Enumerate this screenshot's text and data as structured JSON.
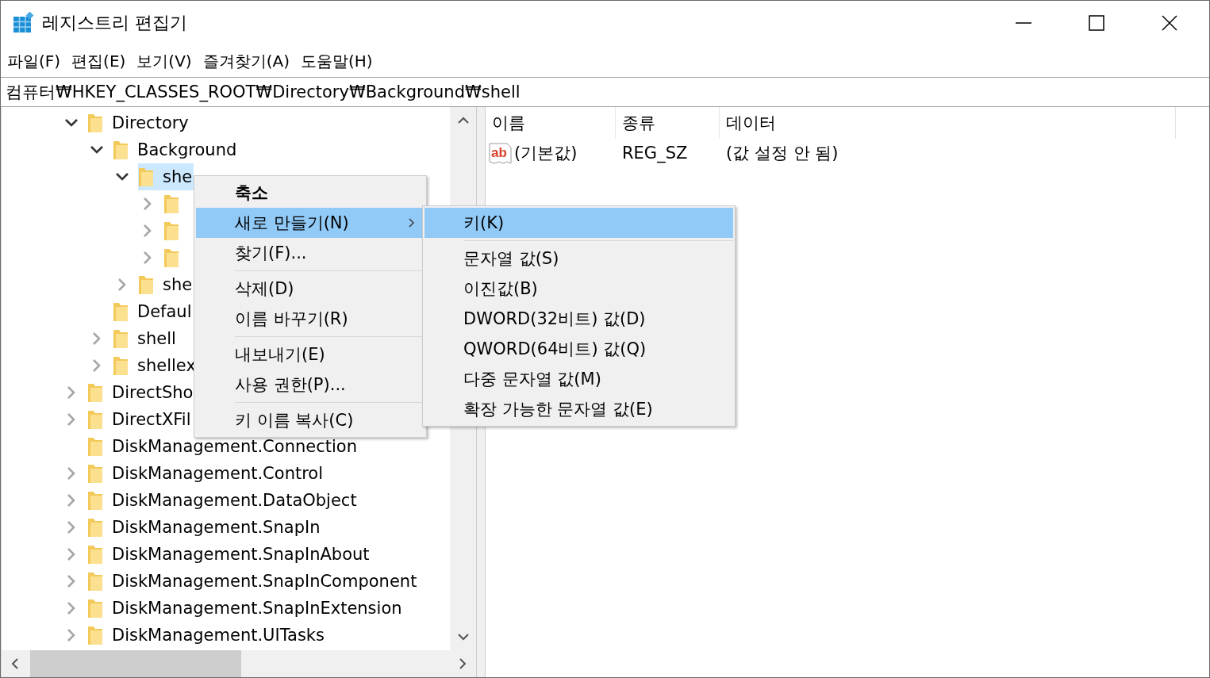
{
  "window": {
    "title": "레지스트리 편집기"
  },
  "menu_bar": [
    "파일(F)",
    "편집(E)",
    "보기(V)",
    "즐겨찾기(A)",
    "도움말(H)"
  ],
  "address": "컴퓨터₩HKEY_CLASSES_ROOT₩Directory₩Background₩shell",
  "tree": [
    {
      "label": "Directory",
      "expanded": true,
      "selected": false,
      "children": [
        {
          "label": "Background",
          "expanded": true,
          "selected": false,
          "children": [
            {
              "label": "she",
              "expanded": true,
              "selected": true,
              "children": [
                {
                  "expanded": false,
                  "selected": false
                },
                {
                  "expanded": false,
                  "selected": false
                },
                {
                  "expanded": false,
                  "selected": false
                }
              ]
            },
            {
              "label": "she",
              "expanded": false,
              "selected": false
            }
          ]
        },
        {
          "label": "Defaul",
          "selected": false
        },
        {
          "label": "shell",
          "expanded": false,
          "selected": false
        },
        {
          "label": "shellex",
          "expanded": false,
          "selected": false
        }
      ]
    },
    {
      "label": "DirectSho",
      "expanded": false,
      "selected": false
    },
    {
      "label": "DirectXFil",
      "expanded": false,
      "selected": false
    },
    {
      "label": "DiskManagement.Connection",
      "selected": false
    },
    {
      "label": "DiskManagement.Control",
      "expanded": false,
      "selected": false
    },
    {
      "label": "DiskManagement.DataObject",
      "expanded": false,
      "selected": false
    },
    {
      "label": "DiskManagement.SnapIn",
      "expanded": false,
      "selected": false
    },
    {
      "label": "DiskManagement.SnapInAbout",
      "expanded": false,
      "selected": false
    },
    {
      "label": "DiskManagement.SnapInComponent",
      "expanded": false,
      "selected": false
    },
    {
      "label": "DiskManagement.SnapInExtension",
      "expanded": false,
      "selected": false
    },
    {
      "label": "DiskManagement.UITasks",
      "expanded": false,
      "selected": false
    }
  ],
  "values_table": {
    "columns": [
      "이름",
      "종류",
      "데이터"
    ],
    "rows": [
      {
        "icon_text": "ab",
        "name": "(기본값)",
        "type": "REG_SZ",
        "data": "(값 설정 안 됨)"
      }
    ]
  },
  "context_menu": {
    "items": [
      {
        "kind": "bold",
        "label": "축소",
        "selected": false
      },
      {
        "kind": "submenu",
        "label": "새로 만들기(N)",
        "selected": true
      },
      {
        "kind": "item",
        "label": "찾기(F)...",
        "selected": false
      },
      {
        "kind": "separator"
      },
      {
        "kind": "item",
        "label": "삭제(D)",
        "selected": false
      },
      {
        "kind": "item",
        "label": "이름 바꾸기(R)",
        "selected": false
      },
      {
        "kind": "separator"
      },
      {
        "kind": "item",
        "label": "내보내기(E)",
        "selected": false
      },
      {
        "kind": "item",
        "label": "사용 권한(P)...",
        "selected": false
      },
      {
        "kind": "separator"
      },
      {
        "kind": "item",
        "label": "키 이름 복사(C)",
        "selected": false
      }
    ]
  },
  "submenu": {
    "items": [
      {
        "kind": "item",
        "label": "키(K)",
        "selected": true
      },
      {
        "kind": "separator"
      },
      {
        "kind": "item",
        "label": "문자열 값(S)",
        "selected": false
      },
      {
        "kind": "item",
        "label": "이진값(B)",
        "selected": false
      },
      {
        "kind": "item",
        "label": "DWORD(32비트) 값(D)",
        "selected": false
      },
      {
        "kind": "item",
        "label": "QWORD(64비트) 값(Q)",
        "selected": false
      },
      {
        "kind": "item",
        "label": "다중 문자열 값(M)",
        "selected": false
      },
      {
        "kind": "item",
        "label": "확장 가능한 문자열 값(E)",
        "selected": false
      }
    ]
  }
}
